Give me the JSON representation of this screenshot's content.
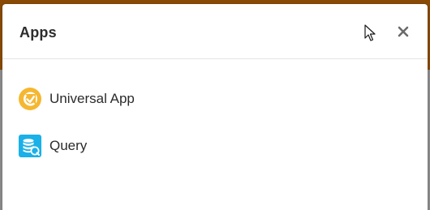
{
  "modal": {
    "title": "Apps",
    "close_icon": "close-icon",
    "items": [
      {
        "label": "Universal App",
        "icon": "universal-app-icon",
        "color": "#f5b731"
      },
      {
        "label": "Query",
        "icon": "query-database-icon",
        "color": "#1ab0e8"
      }
    ]
  },
  "colors": {
    "backdrop_accent": "#8a4a06",
    "overlay": "#8e8e8e"
  }
}
